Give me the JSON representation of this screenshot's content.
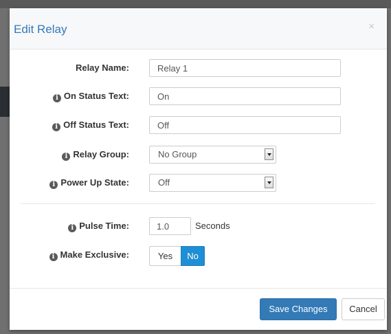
{
  "dialog": {
    "title": "Edit Relay",
    "close_glyph": "×"
  },
  "fields": {
    "relay_name": {
      "label": "Relay Name:",
      "value": "Relay 1"
    },
    "on_status_text": {
      "label": "On Status Text:",
      "value": "On",
      "icon": "info-icon"
    },
    "off_status_text": {
      "label": "Off Status Text:",
      "value": "Off",
      "icon": "info-icon"
    },
    "relay_group": {
      "label": "Relay Group:",
      "selected": "No Group",
      "icon": "info-icon"
    },
    "power_up_state": {
      "label": "Power Up State:",
      "selected": "Off",
      "icon": "info-icon"
    },
    "pulse_time": {
      "label": "Pulse Time:",
      "value": "1.0",
      "unit": "Seconds",
      "icon": "info-icon"
    },
    "make_exclusive": {
      "label": "Make Exclusive:",
      "yes_label": "Yes",
      "no_label": "No",
      "selected": "No",
      "icon": "info-icon"
    }
  },
  "footer": {
    "save_label": "Save Changes",
    "cancel_label": "Cancel"
  },
  "colors": {
    "title": "#337ab7",
    "primary_button": "#337ab7",
    "toggle_active": "#1e8fd4"
  }
}
